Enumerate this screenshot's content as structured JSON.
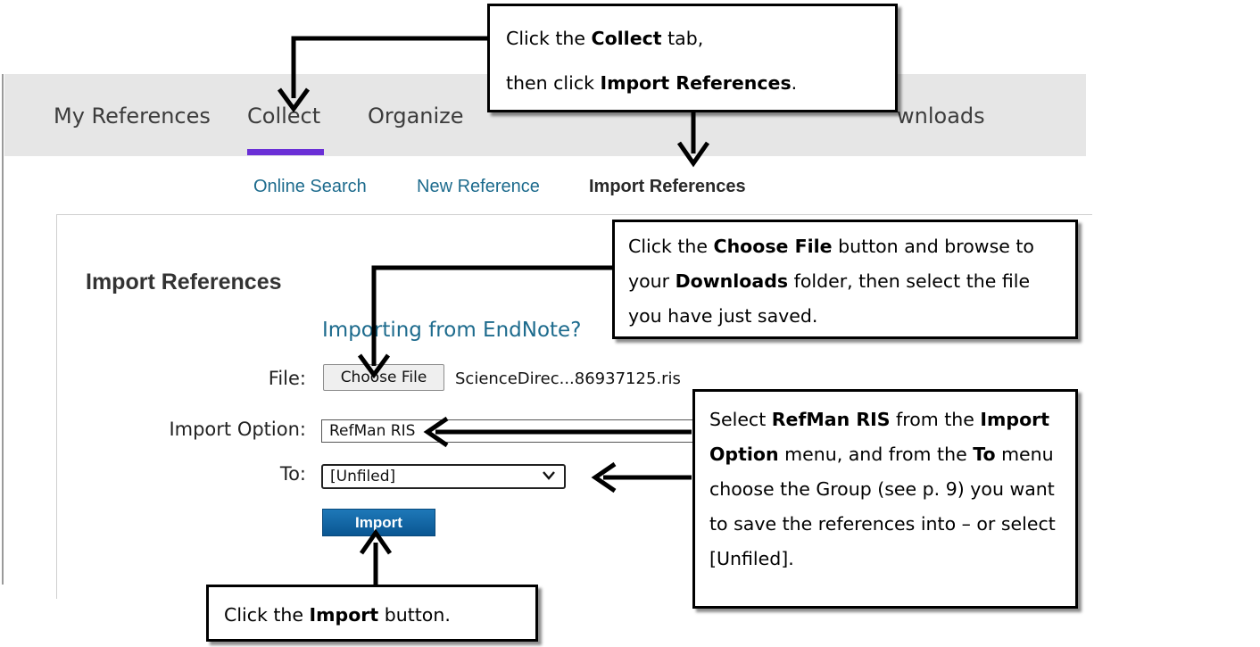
{
  "nav": {
    "items": [
      "My References",
      "Collect",
      "Organize",
      "wnloads"
    ],
    "active": "Collect"
  },
  "subtabs": {
    "online_search": "Online Search",
    "new_reference": "New Reference",
    "import_references": "Import References"
  },
  "form": {
    "title": "Import References",
    "endnote_link": "Importing from EndNote?",
    "file_label": "File:",
    "choose_file": "Choose File",
    "file_name": "ScienceDirec...86937125.ris",
    "import_option_label": "Import Option:",
    "import_option_value": "RefMan RIS",
    "to_label": "To:",
    "to_value": "[Unfiled]",
    "import_button": "Import"
  },
  "callouts": {
    "collect": {
      "l1a": "Click the ",
      "l1b": "Collect",
      "l1c": " tab,",
      "l2a": "then click ",
      "l2b": "Import References",
      "l2c": "."
    },
    "choose_file": {
      "a": "Click the ",
      "b": "Choose File",
      "c": " button and browse to your ",
      "d": "Downloads",
      "e": " folder, then select the file you have just saved."
    },
    "import_option": {
      "a": "Select ",
      "b": "RefMan RIS",
      "c": " from the ",
      "d": "Import Option",
      "e": " menu, and from the ",
      "f": "To",
      "g": " menu choose the Group (see p. 9) you want to save the references into – or select [Unfiled]."
    },
    "import_button": {
      "a": "Click the ",
      "b": "Import",
      "c": " button."
    }
  },
  "colors": {
    "nav_bg": "#e6e6e6",
    "active_underline": "#6a2fd6",
    "link": "#1d6b8d",
    "import_button": "#0a5692"
  }
}
